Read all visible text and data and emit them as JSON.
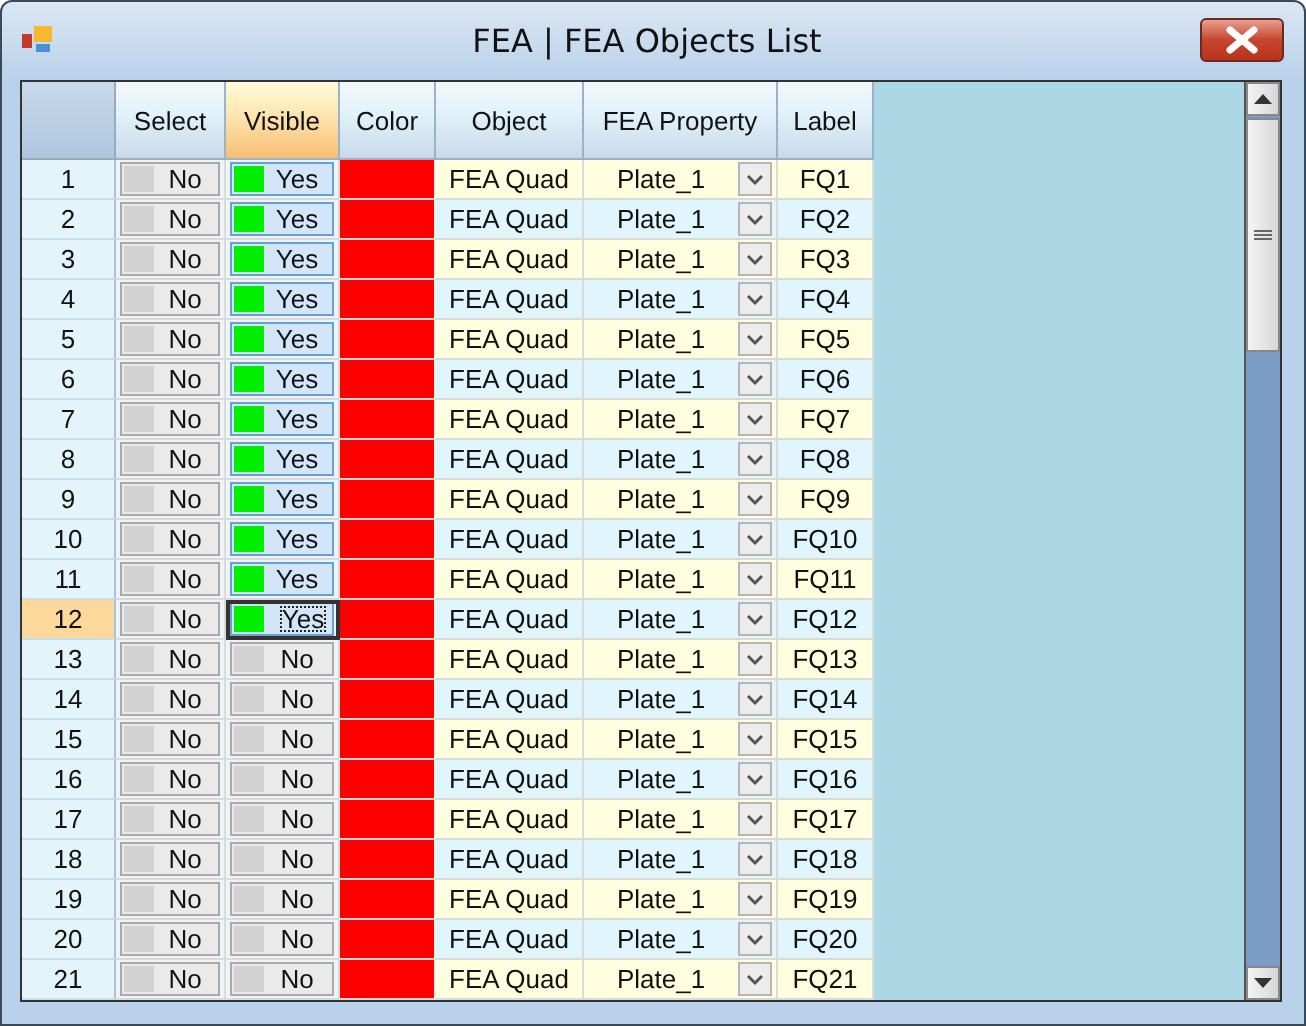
{
  "window": {
    "title": "FEA | FEA Objects List"
  },
  "table": {
    "columns": [
      {
        "label": "Select",
        "selected": false
      },
      {
        "label": "Visible",
        "selected": true
      },
      {
        "label": "Color",
        "selected": false
      },
      {
        "label": "Object",
        "selected": false
      },
      {
        "label": "FEA Property",
        "selected": false
      },
      {
        "label": "Label",
        "selected": false
      }
    ],
    "rows": [
      {
        "number": "1",
        "selected": false,
        "select": {
          "text": "No",
          "on": false
        },
        "visible": {
          "text": "Yes",
          "on": true
        },
        "color": "#ff0000",
        "object": "FEA Quad",
        "property": "Plate_1",
        "label": "FQ1"
      },
      {
        "number": "2",
        "selected": false,
        "select": {
          "text": "No",
          "on": false
        },
        "visible": {
          "text": "Yes",
          "on": true
        },
        "color": "#ff0000",
        "object": "FEA Quad",
        "property": "Plate_1",
        "label": "FQ2"
      },
      {
        "number": "3",
        "selected": false,
        "select": {
          "text": "No",
          "on": false
        },
        "visible": {
          "text": "Yes",
          "on": true
        },
        "color": "#ff0000",
        "object": "FEA Quad",
        "property": "Plate_1",
        "label": "FQ3"
      },
      {
        "number": "4",
        "selected": false,
        "select": {
          "text": "No",
          "on": false
        },
        "visible": {
          "text": "Yes",
          "on": true
        },
        "color": "#ff0000",
        "object": "FEA Quad",
        "property": "Plate_1",
        "label": "FQ4"
      },
      {
        "number": "5",
        "selected": false,
        "select": {
          "text": "No",
          "on": false
        },
        "visible": {
          "text": "Yes",
          "on": true
        },
        "color": "#ff0000",
        "object": "FEA Quad",
        "property": "Plate_1",
        "label": "FQ5"
      },
      {
        "number": "6",
        "selected": false,
        "select": {
          "text": "No",
          "on": false
        },
        "visible": {
          "text": "Yes",
          "on": true
        },
        "color": "#ff0000",
        "object": "FEA Quad",
        "property": "Plate_1",
        "label": "FQ6"
      },
      {
        "number": "7",
        "selected": false,
        "select": {
          "text": "No",
          "on": false
        },
        "visible": {
          "text": "Yes",
          "on": true
        },
        "color": "#ff0000",
        "object": "FEA Quad",
        "property": "Plate_1",
        "label": "FQ7"
      },
      {
        "number": "8",
        "selected": false,
        "select": {
          "text": "No",
          "on": false
        },
        "visible": {
          "text": "Yes",
          "on": true
        },
        "color": "#ff0000",
        "object": "FEA Quad",
        "property": "Plate_1",
        "label": "FQ8"
      },
      {
        "number": "9",
        "selected": false,
        "select": {
          "text": "No",
          "on": false
        },
        "visible": {
          "text": "Yes",
          "on": true
        },
        "color": "#ff0000",
        "object": "FEA Quad",
        "property": "Plate_1",
        "label": "FQ9"
      },
      {
        "number": "10",
        "selected": false,
        "select": {
          "text": "No",
          "on": false
        },
        "visible": {
          "text": "Yes",
          "on": true
        },
        "color": "#ff0000",
        "object": "FEA Quad",
        "property": "Plate_1",
        "label": "FQ10"
      },
      {
        "number": "11",
        "selected": false,
        "select": {
          "text": "No",
          "on": false
        },
        "visible": {
          "text": "Yes",
          "on": true
        },
        "color": "#ff0000",
        "object": "FEA Quad",
        "property": "Plate_1",
        "label": "FQ11"
      },
      {
        "number": "12",
        "selected": true,
        "select": {
          "text": "No",
          "on": false
        },
        "visible": {
          "text": "Yes",
          "on": true
        },
        "color": "#ff0000",
        "object": "FEA Quad",
        "property": "Plate_1",
        "label": "FQ12"
      },
      {
        "number": "13",
        "selected": false,
        "select": {
          "text": "No",
          "on": false
        },
        "visible": {
          "text": "No",
          "on": false
        },
        "color": "#ff0000",
        "object": "FEA Quad",
        "property": "Plate_1",
        "label": "FQ13"
      },
      {
        "number": "14",
        "selected": false,
        "select": {
          "text": "No",
          "on": false
        },
        "visible": {
          "text": "No",
          "on": false
        },
        "color": "#ff0000",
        "object": "FEA Quad",
        "property": "Plate_1",
        "label": "FQ14"
      },
      {
        "number": "15",
        "selected": false,
        "select": {
          "text": "No",
          "on": false
        },
        "visible": {
          "text": "No",
          "on": false
        },
        "color": "#ff0000",
        "object": "FEA Quad",
        "property": "Plate_1",
        "label": "FQ15"
      },
      {
        "number": "16",
        "selected": false,
        "select": {
          "text": "No",
          "on": false
        },
        "visible": {
          "text": "No",
          "on": false
        },
        "color": "#ff0000",
        "object": "FEA Quad",
        "property": "Plate_1",
        "label": "FQ16"
      },
      {
        "number": "17",
        "selected": false,
        "select": {
          "text": "No",
          "on": false
        },
        "visible": {
          "text": "No",
          "on": false
        },
        "color": "#ff0000",
        "object": "FEA Quad",
        "property": "Plate_1",
        "label": "FQ17"
      },
      {
        "number": "18",
        "selected": false,
        "select": {
          "text": "No",
          "on": false
        },
        "visible": {
          "text": "No",
          "on": false
        },
        "color": "#ff0000",
        "object": "FEA Quad",
        "property": "Plate_1",
        "label": "FQ18"
      },
      {
        "number": "19",
        "selected": false,
        "select": {
          "text": "No",
          "on": false
        },
        "visible": {
          "text": "No",
          "on": false
        },
        "color": "#ff0000",
        "object": "FEA Quad",
        "property": "Plate_1",
        "label": "FQ19"
      },
      {
        "number": "20",
        "selected": false,
        "select": {
          "text": "No",
          "on": false
        },
        "visible": {
          "text": "No",
          "on": false
        },
        "color": "#ff0000",
        "object": "FEA Quad",
        "property": "Plate_1",
        "label": "FQ20"
      },
      {
        "number": "21",
        "selected": false,
        "select": {
          "text": "No",
          "on": false
        },
        "visible": {
          "text": "No",
          "on": false
        },
        "color": "#ff0000",
        "object": "FEA Quad",
        "property": "Plate_1",
        "label": "FQ21"
      }
    ]
  }
}
